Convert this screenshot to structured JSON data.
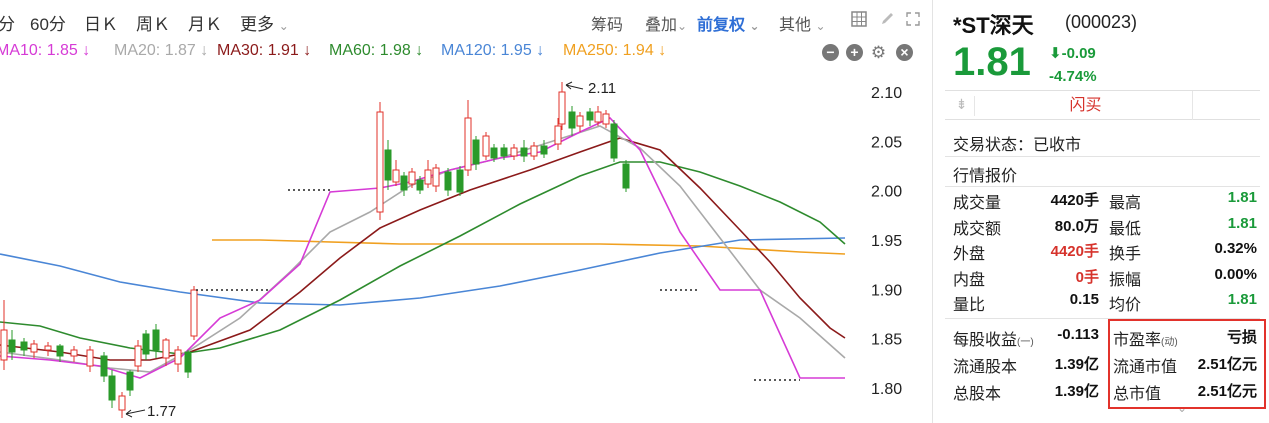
{
  "toolbar": {
    "periods": [
      "分",
      "60分",
      "日Ｋ",
      "周Ｋ",
      "月Ｋ",
      "更多"
    ],
    "tools": [
      "筹码",
      "叠加",
      "前复权",
      "其他"
    ],
    "more_caret": "⌄",
    "icons": [
      "grid-icon",
      "pen-icon",
      "fullscreen-icon"
    ]
  },
  "ma": [
    {
      "label": "MA10: 1.85",
      "color": "#d63bd6"
    },
    {
      "label": "MA20: 1.87",
      "color": "#a9a9a9"
    },
    {
      "label": "MA30: 1.91",
      "color": "#8b1a1a"
    },
    {
      "label": "MA60: 1.98",
      "color": "#2e8b2e"
    },
    {
      "label": "MA120: 1.95",
      "color": "#4a86d6"
    },
    {
      "label": "MA250: 1.94",
      "color": "#f0a020"
    }
  ],
  "ma_arrow": "↓",
  "chart_data": {
    "type": "candlestick",
    "y_ticks": [
      "2.10",
      "2.05",
      "2.00",
      "1.95",
      "1.90",
      "1.85",
      "1.80"
    ],
    "annotations": [
      {
        "label": "2.11"
      },
      {
        "label": "1.77"
      }
    ],
    "ylim": [
      1.77,
      2.12
    ]
  },
  "quote": {
    "name": "*ST深天",
    "code": "(000023)",
    "price": "1.81",
    "change": "-0.09",
    "change_pct": "-4.74%",
    "flash_sell": "闪买",
    "status": "交易状态：已收市",
    "section": "行情报价",
    "grid": [
      {
        "l1": "成交量",
        "v1": "4420手",
        "c1": "black",
        "l2": "最高",
        "v2": "1.81",
        "c2": "green"
      },
      {
        "l1": "成交额",
        "v1": "80.0万",
        "c1": "black",
        "l2": "最低",
        "v2": "1.81",
        "c2": "green"
      },
      {
        "l1": "外盘",
        "v1": "4420手",
        "c1": "red",
        "l2": "换手",
        "v2": "0.32%",
        "c2": "black"
      },
      {
        "l1": "内盘",
        "v1": "0手",
        "c1": "red",
        "l2": "振幅",
        "v2": "0.00%",
        "c2": "black"
      },
      {
        "l1": "量比",
        "v1": "0.15",
        "c1": "black",
        "l2": "均价",
        "v2": "1.81",
        "c2": "green"
      }
    ],
    "fund": [
      {
        "l1": "每股收益",
        "s1": "(一)",
        "v1": "-0.113",
        "l2": "市盈率",
        "s2": "(动)",
        "v2": "亏损"
      },
      {
        "l1": "流通股本",
        "s1": "",
        "v1": "1.39亿",
        "l2": "流通市值",
        "s2": "",
        "v2": "2.51亿元"
      },
      {
        "l1": "总股本",
        "s1": "",
        "v1": "1.39亿",
        "l2": "总市值",
        "s2": "",
        "v2": "2.51亿元"
      }
    ]
  }
}
